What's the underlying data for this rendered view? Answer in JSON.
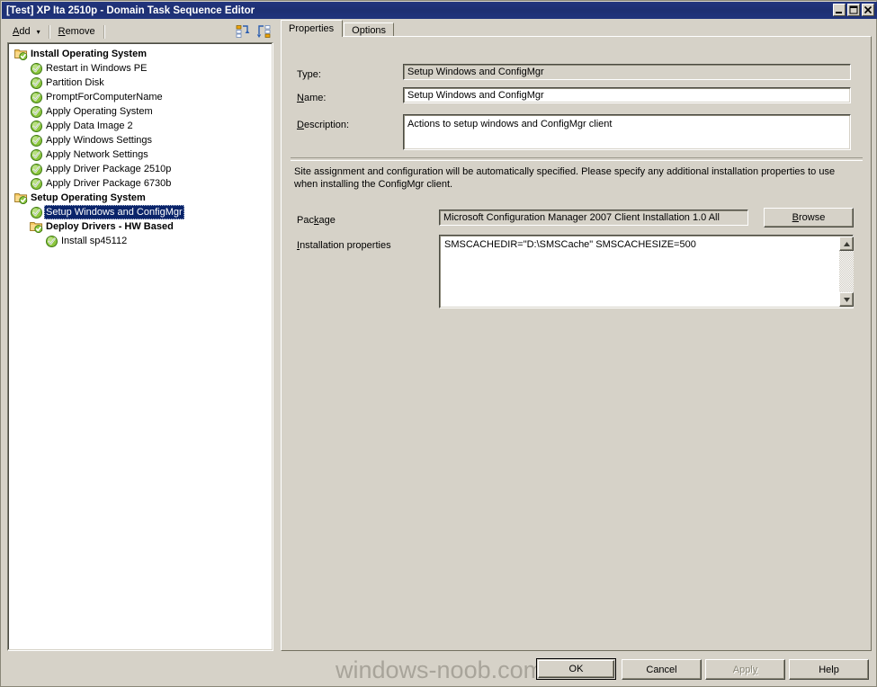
{
  "window": {
    "title": "[Test] XP Ita 2510p - Domain Task Sequence Editor",
    "buttons": {
      "minimize": "minimize-icon",
      "maximize": "maximize-icon",
      "close": "close-icon"
    }
  },
  "toolbar": {
    "add_label": "Add",
    "add_arrow": "▾",
    "remove_label": "Remove",
    "icon_left": "collapse-all-icon",
    "icon_right": "expand-all-icon"
  },
  "tree": {
    "items": [
      {
        "label": "Install Operating System",
        "icon": "folder-check-icon",
        "indent": 0,
        "bold": true,
        "selected": false
      },
      {
        "label": "Restart in Windows PE",
        "icon": "green-check-icon",
        "indent": 1,
        "bold": false,
        "selected": false
      },
      {
        "label": "Partition Disk",
        "icon": "green-check-icon",
        "indent": 1,
        "bold": false,
        "selected": false
      },
      {
        "label": "PromptForComputerName",
        "icon": "green-check-icon",
        "indent": 1,
        "bold": false,
        "selected": false
      },
      {
        "label": "Apply Operating System",
        "icon": "green-check-icon",
        "indent": 1,
        "bold": false,
        "selected": false
      },
      {
        "label": "Apply Data Image 2",
        "icon": "green-check-icon",
        "indent": 1,
        "bold": false,
        "selected": false
      },
      {
        "label": "Apply Windows Settings",
        "icon": "green-check-icon",
        "indent": 1,
        "bold": false,
        "selected": false
      },
      {
        "label": "Apply Network Settings",
        "icon": "green-check-icon",
        "indent": 1,
        "bold": false,
        "selected": false
      },
      {
        "label": "Apply Driver Package 2510p",
        "icon": "green-check-icon",
        "indent": 1,
        "bold": false,
        "selected": false
      },
      {
        "label": "Apply Driver Package 6730b",
        "icon": "green-check-icon",
        "indent": 1,
        "bold": false,
        "selected": false
      },
      {
        "label": "Setup Operating System",
        "icon": "folder-check-icon",
        "indent": 0,
        "bold": true,
        "selected": false
      },
      {
        "label": "Setup Windows and ConfigMgr",
        "icon": "green-check-icon",
        "indent": 1,
        "bold": false,
        "selected": true
      },
      {
        "label": "Deploy Drivers - HW Based",
        "icon": "folder-check-icon",
        "indent": 1,
        "bold": true,
        "selected": false
      },
      {
        "label": "Install sp45112",
        "icon": "green-check-icon",
        "indent": 2,
        "bold": false,
        "selected": false
      }
    ]
  },
  "tabs": [
    {
      "label": "Properties",
      "active": true
    },
    {
      "label": "Options",
      "active": false
    }
  ],
  "properties": {
    "type_label": "Type:",
    "type_value": "Setup Windows and ConfigMgr",
    "name_label_pre": "N",
    "name_label_accel": "a",
    "name_label_post": "me:",
    "name_value": "Setup Windows and ConfigMgr",
    "description_label_pre": "D",
    "description_label_accel": "e",
    "description_label_post": "scription:",
    "description_value": "Actions to setup windows and ConfigMgr client",
    "blurb": "Site assignment and configuration will be automatically specified. Please specify any additional installation properties to use when installing the ConfigMgr client.",
    "package_label_pre": "Pac",
    "package_label_accel": "k",
    "package_label_post": "age",
    "package_value": "Microsoft Configuration Manager 2007 Client Installation 1.0 All",
    "browse_label_pre": "B",
    "browse_label_accel": "r",
    "browse_label_post": "owse",
    "install_label_pre": "I",
    "install_label_accel": "n",
    "install_label_post": "stallation properties",
    "install_value": "SMSCACHEDIR=\"D:\\SMSCache\" SMSCACHESIZE=500",
    "scroll_up": "scroll-up-icon",
    "scroll_down": "scroll-down-icon"
  },
  "footer": {
    "ok": "OK",
    "cancel": "Cancel",
    "apply_pre": "Appl",
    "apply_accel": "y",
    "help": "Help",
    "watermark": "windows-noob.com"
  },
  "colors": {
    "titlebar": "#20347c",
    "face": "#d6d2c8",
    "selection": "#0a246a",
    "field": "#ffffff",
    "accent_green": "#4f9e2f"
  }
}
